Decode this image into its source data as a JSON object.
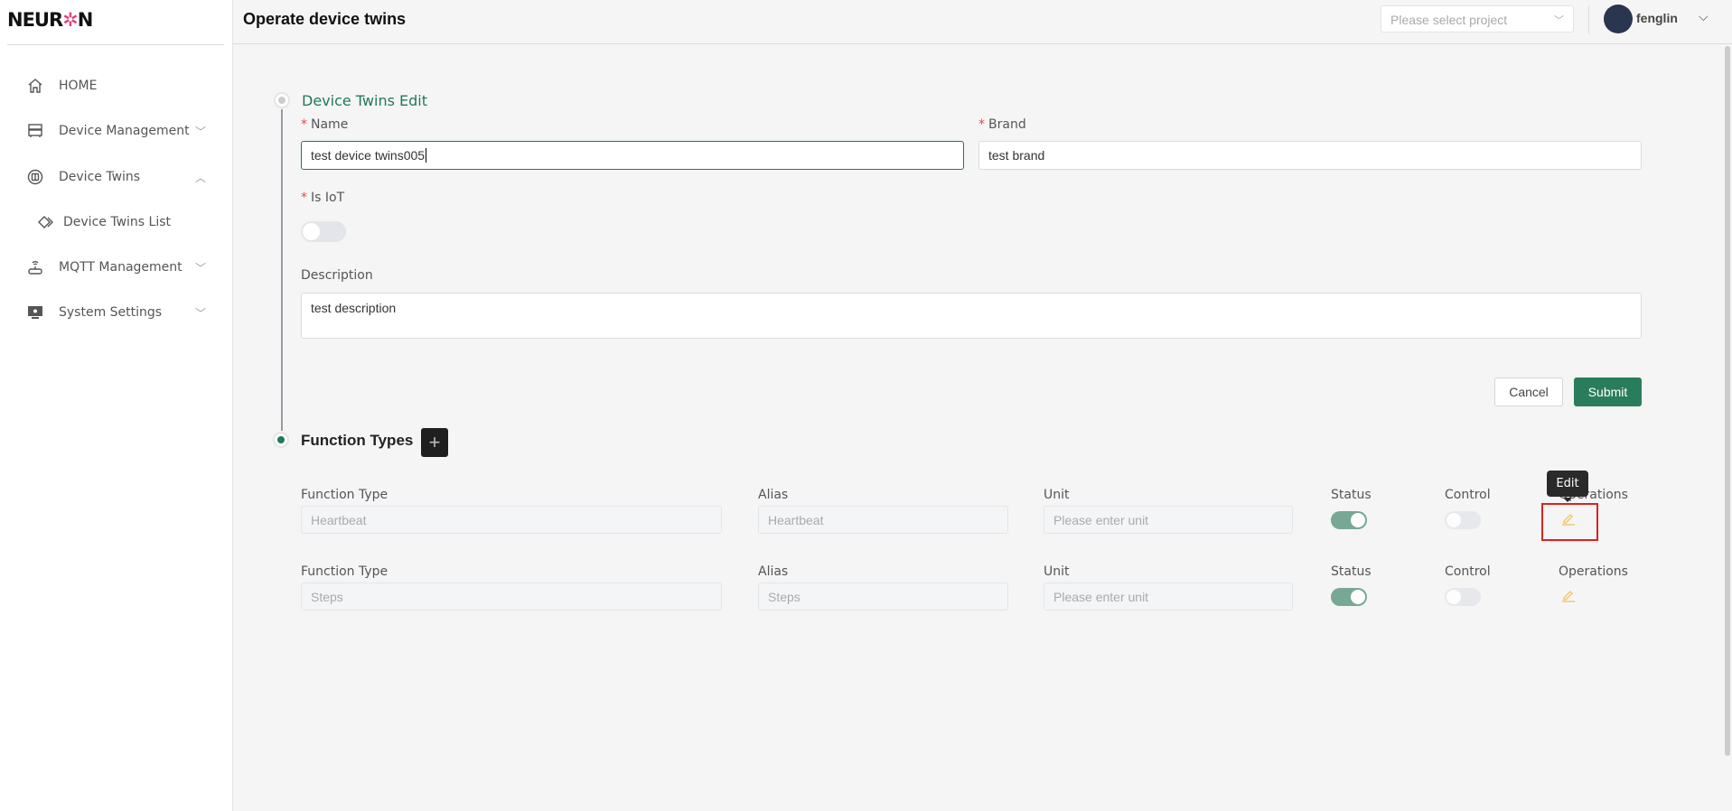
{
  "sidebar": {
    "logo": "NEURON",
    "items": [
      {
        "label": "HOME",
        "icon": "home-icon"
      },
      {
        "label": "Device Management",
        "icon": "server-icon",
        "chevron": "down"
      },
      {
        "label": "Device Twins",
        "icon": "device-twins-icon",
        "chevron": "up"
      },
      {
        "label": "Device Twins List",
        "icon": "diamond-icon",
        "sub": true
      },
      {
        "label": "MQTT Management",
        "icon": "router-icon",
        "chevron": "down"
      },
      {
        "label": "System Settings",
        "icon": "monitor-icon",
        "chevron": "down"
      }
    ]
  },
  "header": {
    "title": "Operate device twins",
    "project_placeholder": "Please select project",
    "user": "fenglin"
  },
  "edit_section": {
    "title": "Device Twins Edit",
    "name_label": "Name",
    "name_value": "test device twins005",
    "brand_label": "Brand",
    "brand_value": "test brand",
    "iot_label": "Is IoT",
    "iot_on": false,
    "description_label": "Description",
    "description_value": "test description",
    "cancel": "Cancel",
    "submit": "Submit"
  },
  "function_section": {
    "title": "Function Types",
    "add": "+",
    "headers": {
      "type": "Function Type",
      "alias": "Alias",
      "unit": "Unit",
      "status": "Status",
      "control": "Control",
      "operations": "Operations"
    },
    "unit_placeholder": "Please enter unit",
    "rows": [
      {
        "type": "Heartbeat",
        "alias": "Heartbeat",
        "unit": "",
        "status": true,
        "control": false
      },
      {
        "type": "Steps",
        "alias": "Steps",
        "unit": "",
        "status": true,
        "control": false
      }
    ]
  },
  "tooltip": "Edit",
  "colors": {
    "accent": "#2a7d5c",
    "edit_icon": "#f5c46a",
    "highlight": "#e02020"
  }
}
